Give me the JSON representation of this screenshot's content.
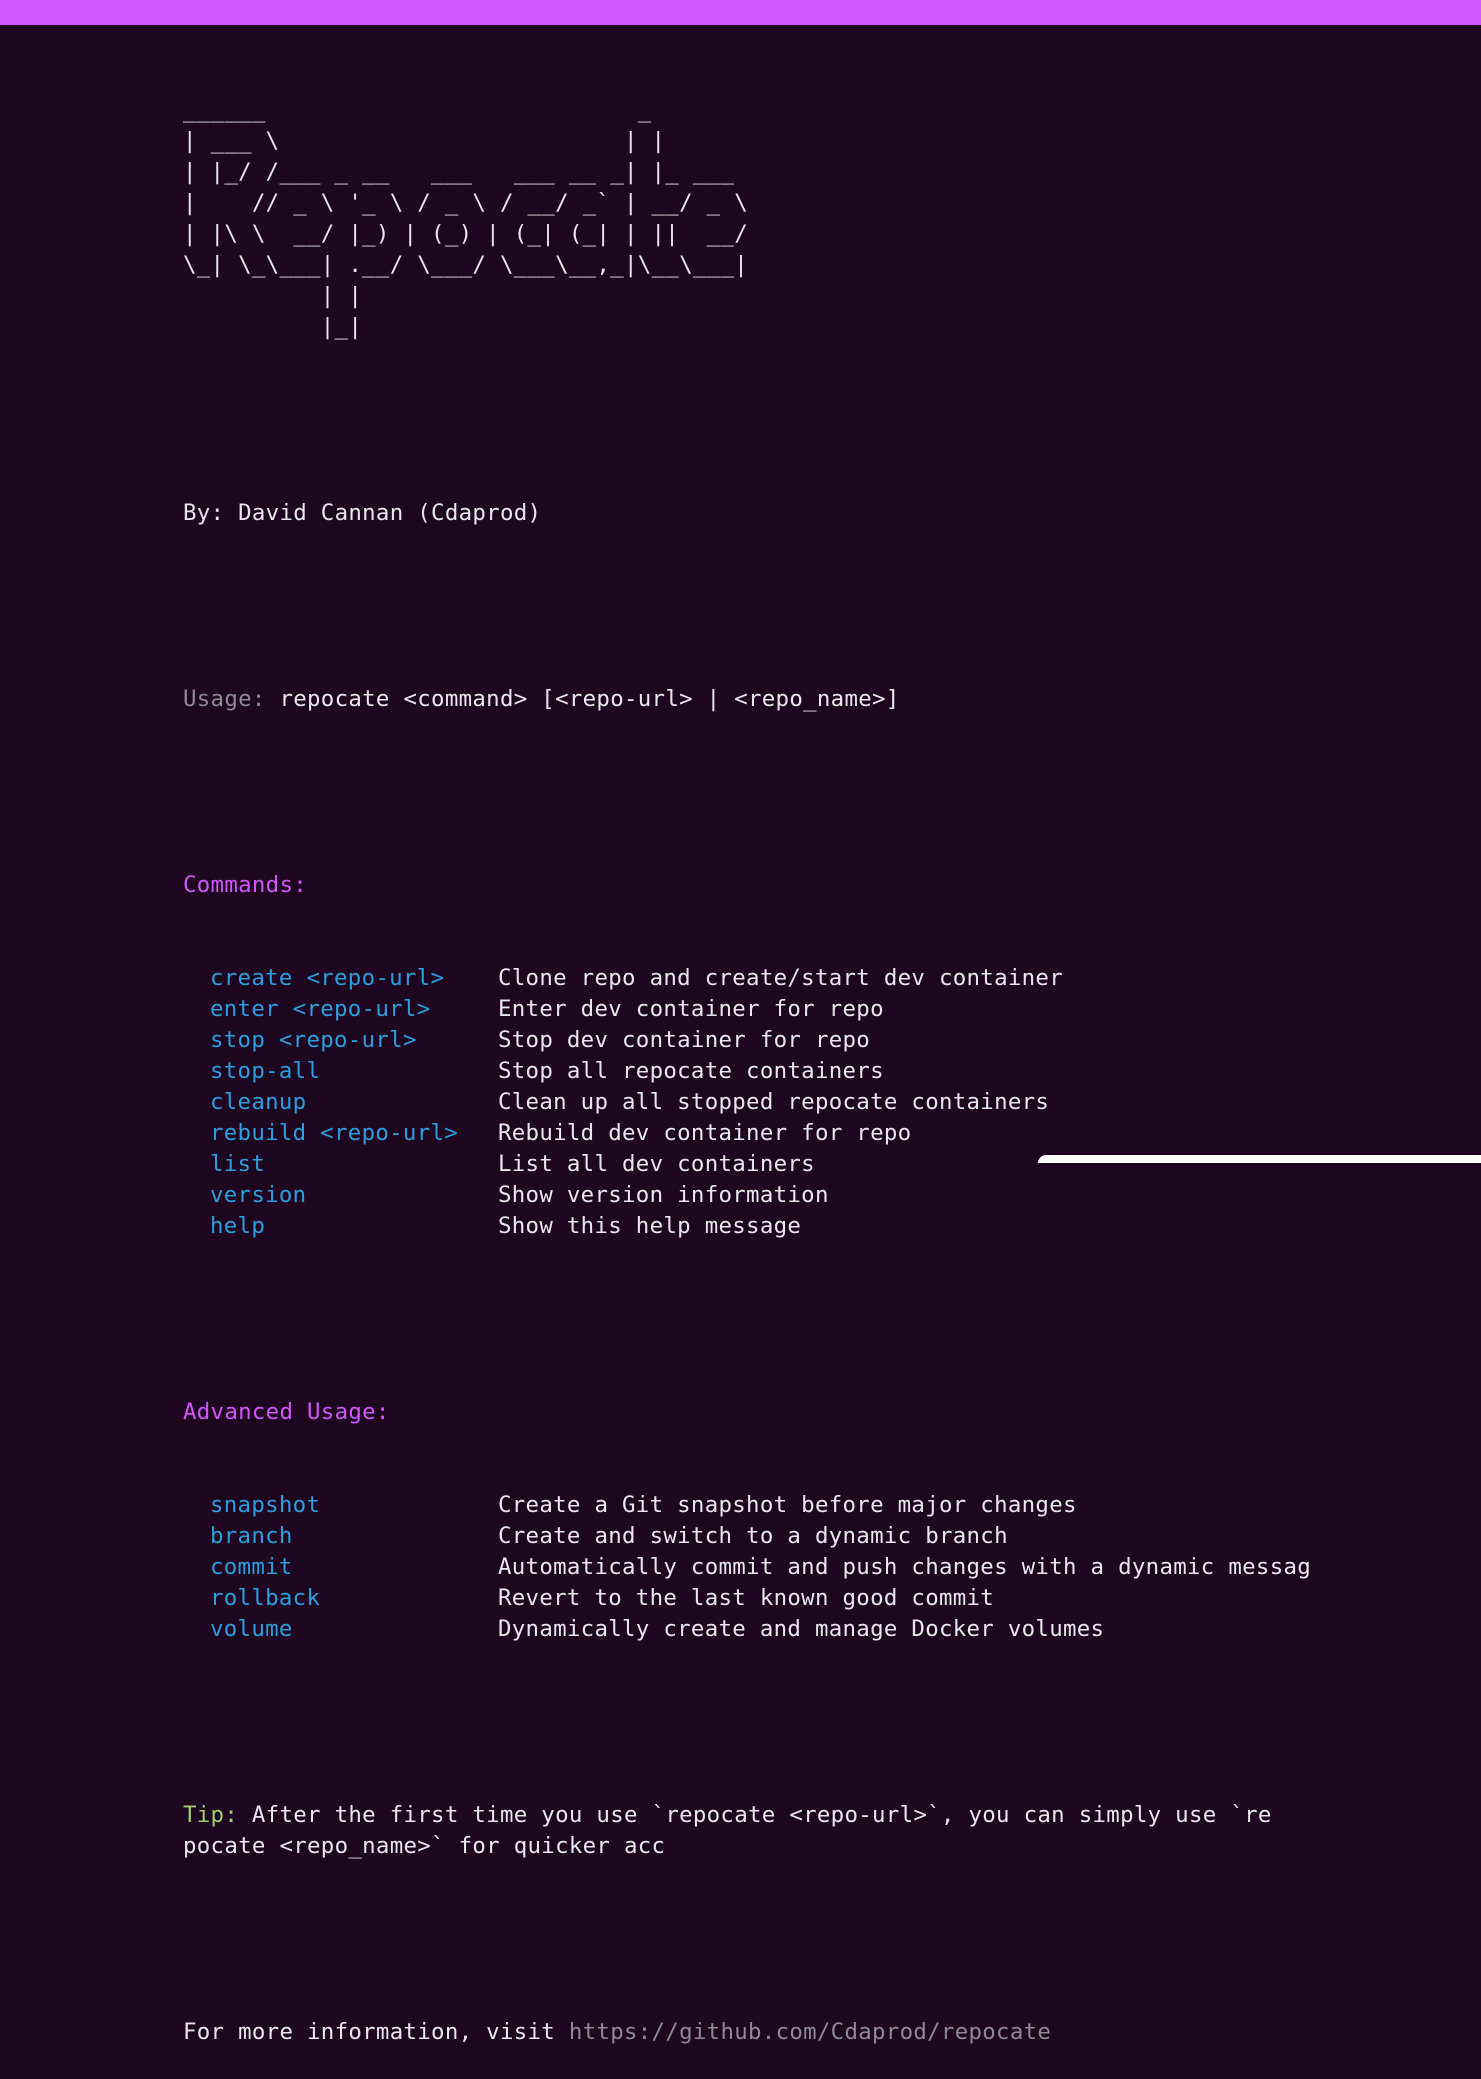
{
  "banner_ascii": "______                           _\n| ___ \\                         | |\n| |_/ /___ _ __   ___   ___ __ _| |_ ___\n|    // _ \\ '_ \\ / _ \\ / __/ _` | __/ _ \\\n| |\\ \\  __/ |_) | (_) | (_| (_| | ||  __/\n\\_| \\_\\___| .__/ \\___/ \\___\\__,_|\\__\\___|\n          | |\n          |_|",
  "author_line": "By: David Cannan (Cdaprod)",
  "usage": {
    "label": "Usage:",
    "text": " repocate <command> [<repo-url> | <repo_name>]"
  },
  "commands": {
    "heading": "Commands:",
    "items": [
      {
        "cmd": "create <repo-url>",
        "desc": "Clone repo and create/start dev container"
      },
      {
        "cmd": "enter <repo-url>",
        "desc": "Enter dev container for repo"
      },
      {
        "cmd": "stop <repo-url>",
        "desc": "Stop dev container for repo"
      },
      {
        "cmd": "stop-all",
        "desc": "Stop all repocate containers"
      },
      {
        "cmd": "cleanup",
        "desc": "Clean up all stopped repocate containers"
      },
      {
        "cmd": "rebuild <repo-url>",
        "desc": "Rebuild dev container for repo"
      },
      {
        "cmd": "list",
        "desc": "List all dev containers"
      },
      {
        "cmd": "version",
        "desc": "Show version information"
      },
      {
        "cmd": "help",
        "desc": "Show this help message"
      }
    ]
  },
  "advanced": {
    "heading": "Advanced Usage:",
    "items": [
      {
        "cmd": "snapshot",
        "desc": "Create a Git snapshot before major changes"
      },
      {
        "cmd": "branch",
        "desc": "Create and switch to a dynamic branch"
      },
      {
        "cmd": "commit",
        "desc": "Automatically commit and push changes with a dynamic messag"
      },
      {
        "cmd": "rollback",
        "desc": "Revert to the last known good commit"
      },
      {
        "cmd": "volume",
        "desc": "Dynamically create and manage Docker volumes"
      }
    ]
  },
  "tip": {
    "label": "Tip:",
    "text": " After the first time you use `repocate <repo-url>`, you can simply use `repocate <repo_name>` for quicker acc"
  },
  "more_info": {
    "text": "For more information, visit ",
    "link": "https://github.com/Cdaprod/repocate"
  },
  "colors": {
    "background": "#1e0520",
    "accent_bar": "#cf57fb",
    "command": "#2b9fde",
    "section_heading": "#cf57fb",
    "tip_label": "#9fcf6e",
    "dim": "#8e8a91"
  }
}
